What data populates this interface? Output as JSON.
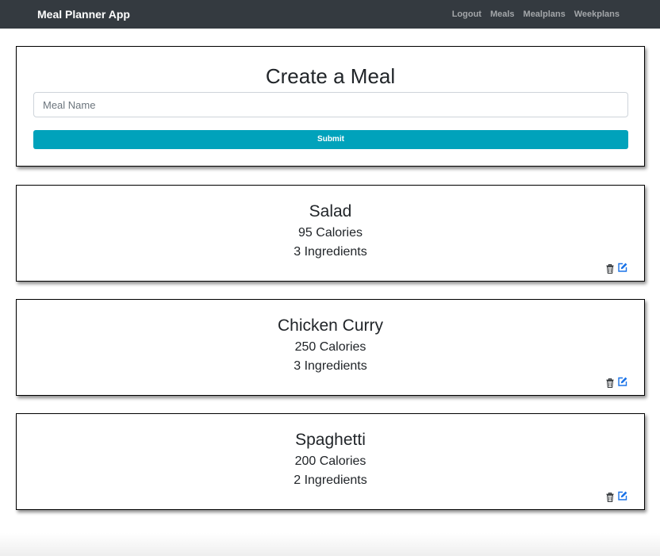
{
  "navbar": {
    "brand": "Meal Planner App",
    "links": [
      "Logout",
      "Meals",
      "Mealplans",
      "Weekplans"
    ]
  },
  "create_form": {
    "title": "Create a Meal",
    "input_placeholder": "Meal Name",
    "input_value": "",
    "submit_label": "Submit"
  },
  "meals": [
    {
      "name": "Salad",
      "calories": "95 Calories",
      "ingredients": "3 Ingredients"
    },
    {
      "name": "Chicken Curry",
      "calories": "250 Calories",
      "ingredients": "3 Ingredients"
    },
    {
      "name": "Spaghetti",
      "calories": "200 Calories",
      "ingredients": "2 Ingredients"
    }
  ],
  "icons": {
    "delete": "trash-icon",
    "edit": "edit-icon"
  },
  "colors": {
    "navbar_bg": "#343a40",
    "submit_bg": "#00a2bb",
    "edit_icon": "#1a73e8",
    "nav_link": "#a3a6a9"
  }
}
